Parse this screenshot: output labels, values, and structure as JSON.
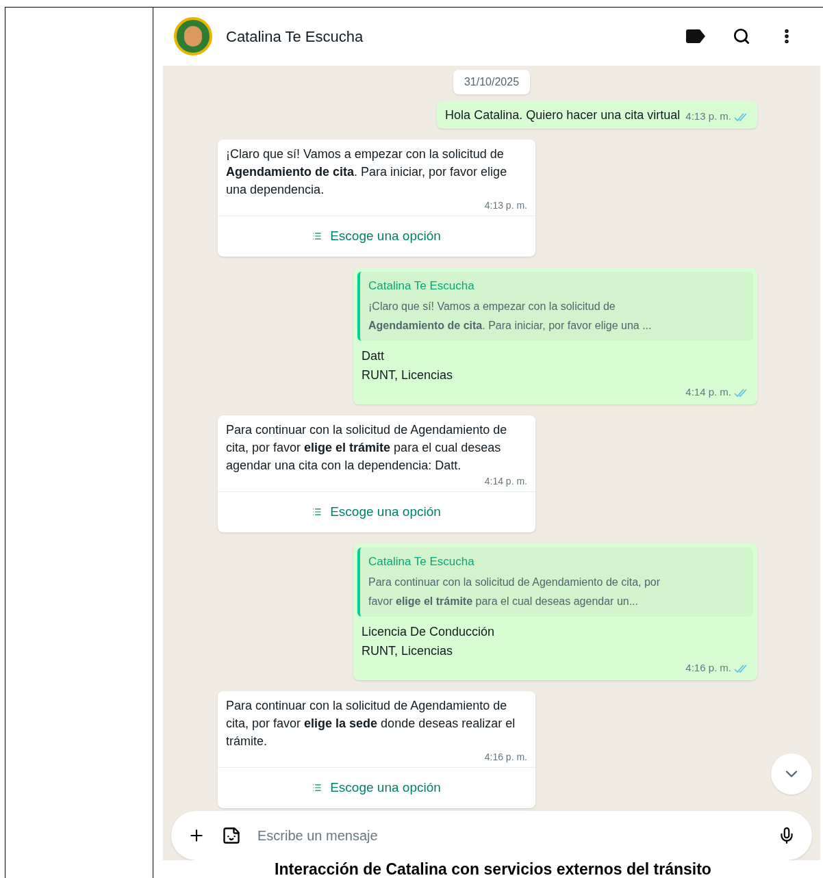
{
  "chat": {
    "title": "Catalina Te Escucha",
    "date": "31/10/2025",
    "messages": [
      {
        "kind": "outgoing",
        "lines": [
          "Hola Catalina. Quiero hacer una cita virtual"
        ],
        "time": "4:13 p. m.",
        "read": true
      },
      {
        "kind": "incoming",
        "text": "¡Claro que sí! Vamos a empezar con la solicitud de **Agendamiento de cita**. Para iniciar, por favor elige una dependencia.",
        "time": "4:13 p. m.",
        "option": "Escoge una opción"
      },
      {
        "kind": "outgoing",
        "quote": {
          "author": "Catalina Te Escucha",
          "text": "¡Claro que sí! Vamos a empezar con la solicitud de **Agendamiento de cita**. Para iniciar, por favor elige una ..."
        },
        "lines": [
          "Datt",
          "RUNT, Licencias"
        ],
        "time": "4:14 p. m.",
        "read": true
      },
      {
        "kind": "incoming",
        "text": "Para continuar con la solicitud de Agendamiento de cita, por favor **elige el trámite** para el cual deseas agendar una cita con la dependencia: Datt.",
        "time": "4:14 p. m.",
        "option": "Escoge una opción"
      },
      {
        "kind": "outgoing",
        "quote": {
          "author": "Catalina Te Escucha",
          "text": "Para continuar con la solicitud de Agendamiento de cita, por favor **elige el trámite** para el cual deseas agendar un..."
        },
        "lines": [
          "Licencia De Conducción",
          "RUNT, Licencias"
        ],
        "time": "4:16 p. m.",
        "read": true
      },
      {
        "kind": "incoming",
        "text": "Para continuar con la solicitud de Agendamiento de cita, por favor **elige la sede** donde deseas realizar el trámite.",
        "time": "4:16 p. m.",
        "option": "Escoge una opción"
      }
    ],
    "composer": {
      "placeholder": "Escribe un mensaje"
    }
  },
  "caption": "Interacción de Catalina con servicios externos del tránsito"
}
